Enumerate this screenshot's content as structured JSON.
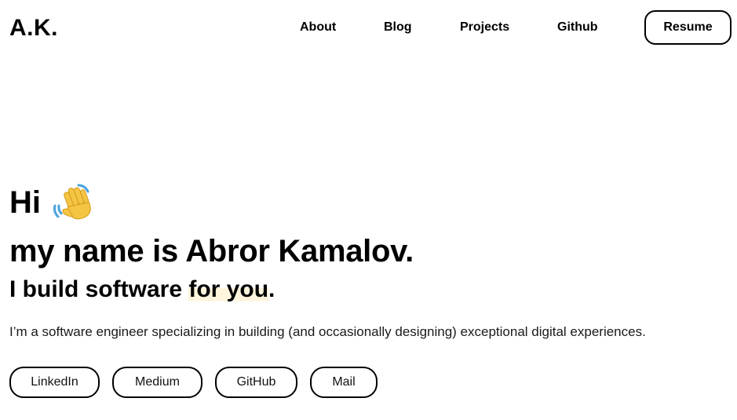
{
  "header": {
    "logo": "A.K.",
    "nav": [
      {
        "label": "About"
      },
      {
        "label": "Blog"
      },
      {
        "label": "Projects"
      },
      {
        "label": "Github"
      }
    ],
    "resume_label": "Resume"
  },
  "hero": {
    "greeting": "Hi",
    "greeting_icon": "waving-hand-icon",
    "name_line": "my name is Abror Kamalov.",
    "tagline_prefix": "I build software ",
    "tagline_highlight": "for you",
    "tagline_suffix": ".",
    "description": "I’m a software engineer specializing in building (and occasionally designing) exceptional digital experiences."
  },
  "social_links": [
    {
      "label": "LinkedIn"
    },
    {
      "label": "Medium"
    },
    {
      "label": "GitHub"
    },
    {
      "label": "Mail"
    }
  ],
  "colors": {
    "text": "#000000",
    "highlight": "#fff4dc",
    "background": "#ffffff"
  }
}
